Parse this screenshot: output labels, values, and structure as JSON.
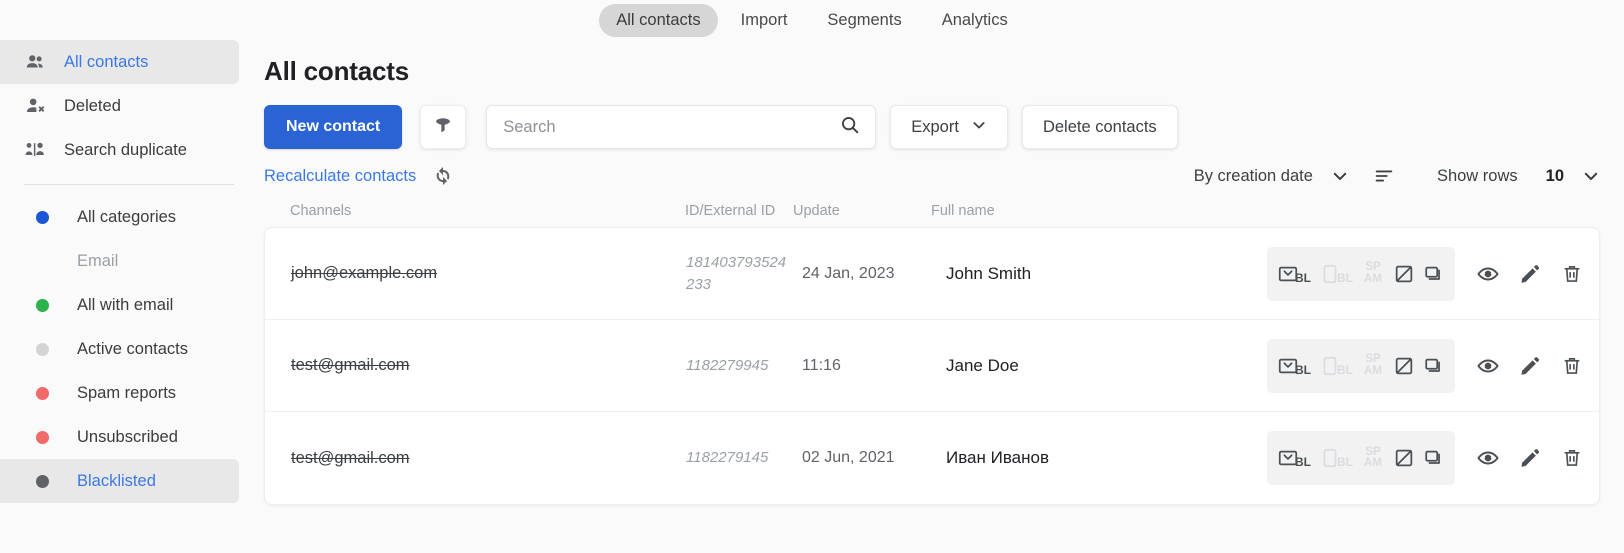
{
  "topbar": {
    "tabs": [
      {
        "label": "All contacts",
        "active": true
      },
      {
        "label": "Import",
        "active": false
      },
      {
        "label": "Segments",
        "active": false
      },
      {
        "label": "Analytics",
        "active": false
      }
    ]
  },
  "sidebar": {
    "nav": [
      {
        "label": "All contacts",
        "icon": "people-icon",
        "active": true
      },
      {
        "label": "Deleted",
        "icon": "person-remove-icon",
        "active": false
      },
      {
        "label": "Search duplicate",
        "icon": "duplicate-people-icon",
        "active": false
      }
    ],
    "categories": [
      {
        "label": "All categories",
        "color": "#1a56d6",
        "active": false,
        "labelOnly": false
      },
      {
        "label": "Email",
        "color": "transparent",
        "active": false,
        "labelOnly": true
      },
      {
        "label": "All with email",
        "color": "#2bb24c",
        "active": false,
        "labelOnly": false
      },
      {
        "label": "Active contacts",
        "color": "#d2d4d6",
        "active": false,
        "labelOnly": false
      },
      {
        "label": "Spam reports",
        "color": "#f06a6a",
        "active": false,
        "labelOnly": false
      },
      {
        "label": "Unsubscribed",
        "color": "#f06a6a",
        "active": false,
        "labelOnly": false
      },
      {
        "label": "Blacklisted",
        "color": "#5f6368",
        "active": true,
        "labelOnly": false
      }
    ]
  },
  "main": {
    "title": "All contacts",
    "toolbar": {
      "new_contact_label": "New contact",
      "filter_icon": "funnel-icon",
      "search_placeholder": "Search",
      "search_value": "",
      "search_icon": "search-icon",
      "export_label": "Export",
      "export_caret": "chevron-down-icon",
      "delete_contacts_label": "Delete contacts"
    },
    "subbar": {
      "recalculate_label": "Recalculate contacts",
      "refresh_icon": "refresh-icon",
      "sort_label": "By creation date",
      "sort_caret": "chevron-down-icon",
      "sort_order_icon": "sort-descending-icon",
      "show_rows_label": "Show rows",
      "rows_value": "10",
      "rows_caret": "chevron-down-icon"
    },
    "table": {
      "headers": {
        "channels": "Channels",
        "id": "ID/External ID",
        "update": "Update",
        "full_name": "Full name"
      },
      "rows": [
        {
          "email": "john@example.com",
          "id": "181403793524233",
          "update": "24 Jan, 2023",
          "full_name": "John Smith",
          "status_icons": [
            {
              "name": "email-blacklist-icon",
              "label": "BL",
              "active": true
            },
            {
              "name": "sms-blacklist-icon",
              "label": "BL",
              "active": false
            },
            {
              "name": "spam-icon",
              "label": "SP AM",
              "active": false
            },
            {
              "name": "unsubscribed-icon",
              "label": "",
              "active": true
            },
            {
              "name": "duplicate-icon",
              "label": "",
              "active": true
            }
          ],
          "actions": [
            "view-icon",
            "edit-icon",
            "delete-icon"
          ]
        },
        {
          "email": "test@gmail.com",
          "id": "1182279945",
          "update": "11:16",
          "full_name": "Jane Doe",
          "status_icons": [
            {
              "name": "email-blacklist-icon",
              "label": "BL",
              "active": true
            },
            {
              "name": "sms-blacklist-icon",
              "label": "BL",
              "active": false
            },
            {
              "name": "spam-icon",
              "label": "SP AM",
              "active": false
            },
            {
              "name": "unsubscribed-icon",
              "label": "",
              "active": true
            },
            {
              "name": "duplicate-icon",
              "label": "",
              "active": true
            }
          ],
          "actions": [
            "view-icon",
            "edit-icon",
            "delete-icon"
          ]
        },
        {
          "email": "test@gmail.com",
          "id": "1182279145",
          "update": "02 Jun, 2021",
          "full_name": "Иван Иванов",
          "status_icons": [
            {
              "name": "email-blacklist-icon",
              "label": "BL",
              "active": true
            },
            {
              "name": "sms-blacklist-icon",
              "label": "BL",
              "active": false
            },
            {
              "name": "spam-icon",
              "label": "SP AM",
              "active": false
            },
            {
              "name": "unsubscribed-icon",
              "label": "",
              "active": true
            },
            {
              "name": "duplicate-icon",
              "label": "",
              "active": true
            }
          ],
          "actions": [
            "view-icon",
            "edit-icon",
            "delete-icon"
          ]
        }
      ]
    }
  },
  "colors": {
    "primary": "#2a64d4",
    "link": "#3b78e7",
    "text": "#3c4043",
    "muted": "#9aa0a6",
    "bg": "#fafafa"
  }
}
